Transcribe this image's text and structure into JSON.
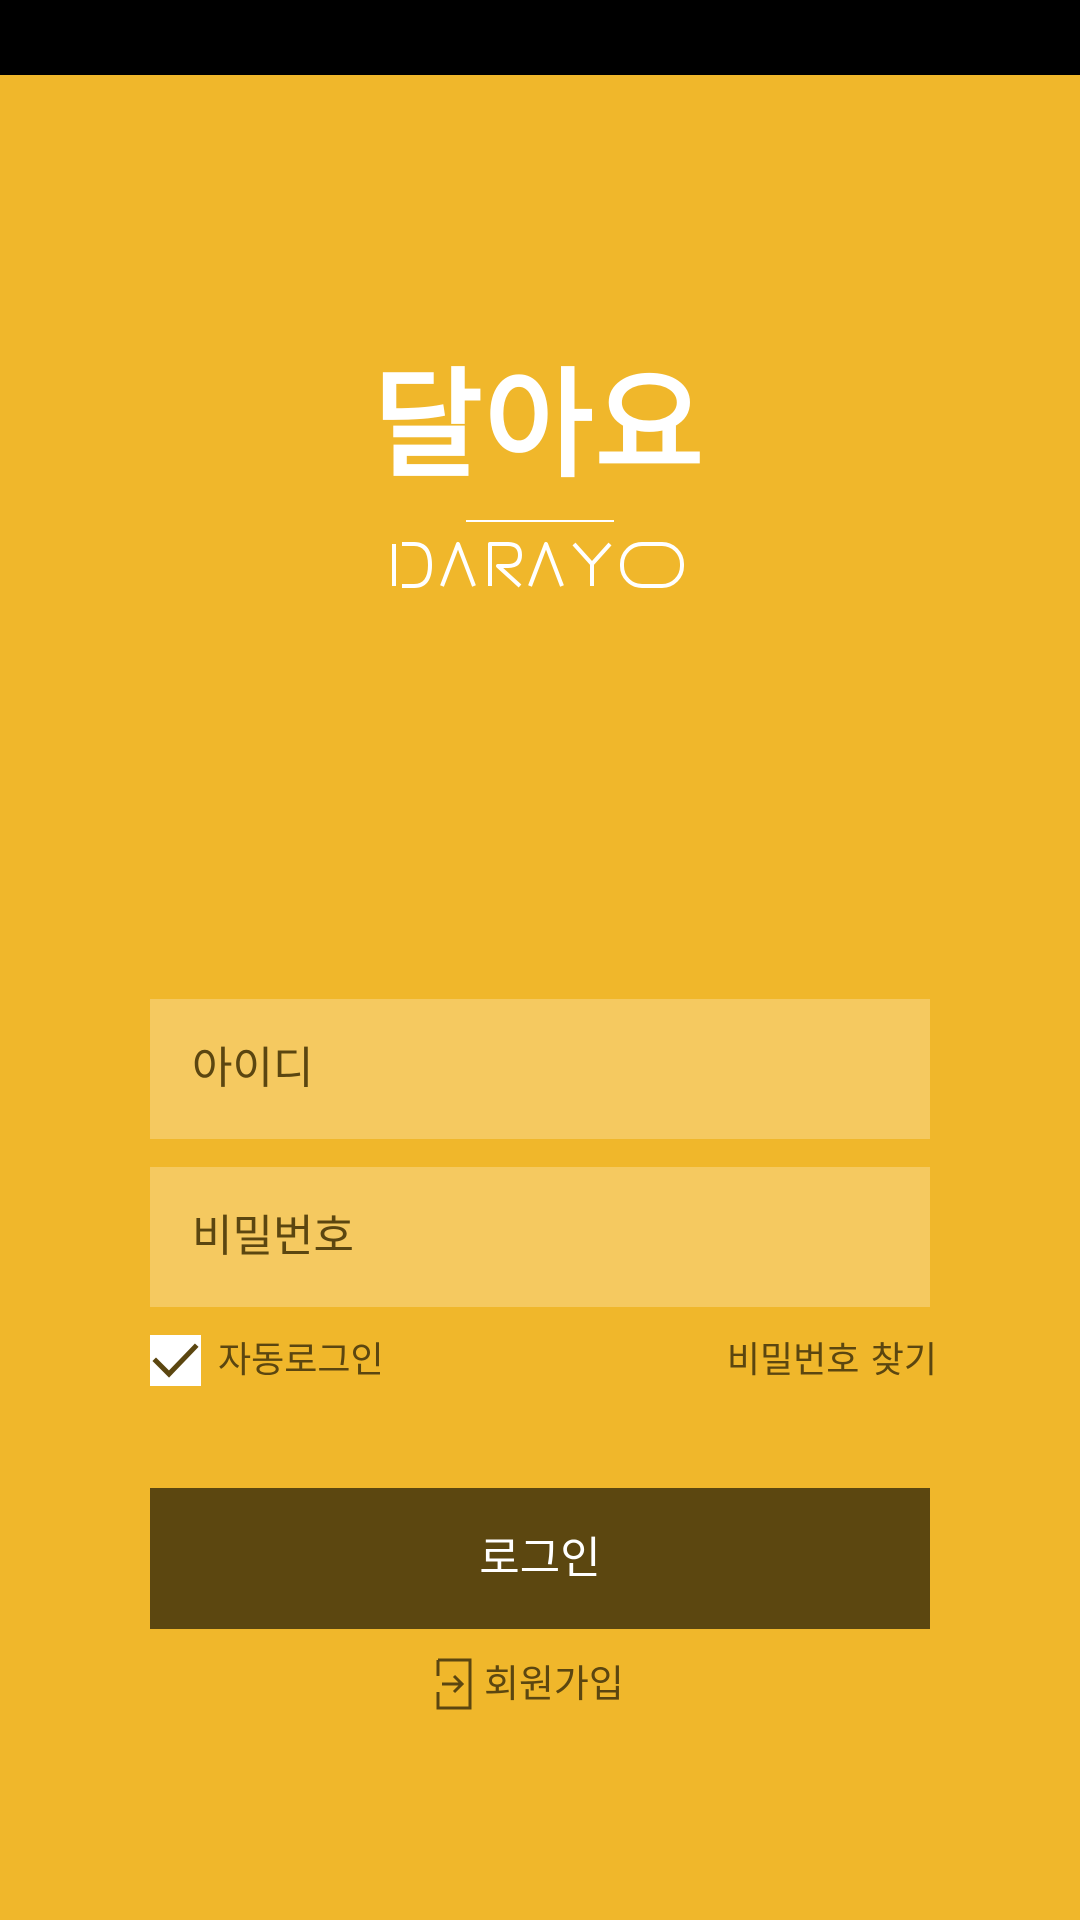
{
  "app": {
    "logo_ko": "달아요",
    "logo_en": "DARAYO"
  },
  "form": {
    "id_placeholder": "아이디",
    "password_placeholder": "비밀번호",
    "auto_login_label": "자동로그인",
    "auto_login_checked": true,
    "find_password_label": "비밀번호 찾기",
    "login_button_label": "로그인",
    "signup_label": "회원가입"
  },
  "colors": {
    "background": "#f0b72b",
    "input_background": "#f5c960",
    "button_background": "#5c4710",
    "text_dark": "#5b4610",
    "text_light": "#ffffff"
  },
  "icons": {
    "checkbox": "checkmark-icon",
    "signup": "sign-in-arrow-icon"
  }
}
